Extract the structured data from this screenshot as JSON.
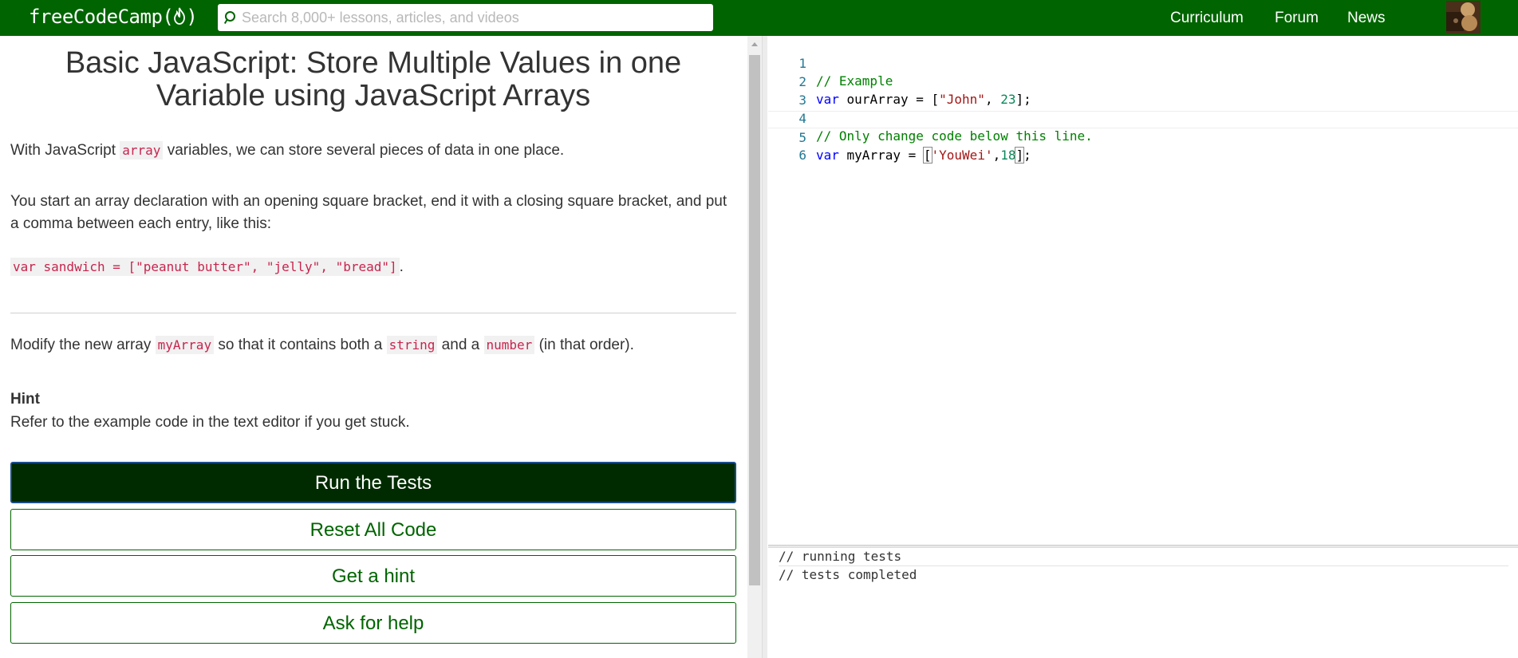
{
  "nav": {
    "logo_text": "freeCodeCamp(",
    "logo_close": ")",
    "search_placeholder": "Search 8,000+ lessons, articles, and videos",
    "links": [
      "Curriculum",
      "Forum",
      "News"
    ],
    "colors": {
      "nav_bg": "#006400",
      "accent": "#006400"
    }
  },
  "lesson": {
    "title": "Basic JavaScript: Store Multiple Values in one Variable using JavaScript Arrays",
    "p1_pre": "With JavaScript ",
    "p1_code": "array",
    "p1_post": " variables, we can store several pieces of data in one place.",
    "p2": "You start an array declaration with an opening square bracket, end it with a closing square bracket, and put a comma between each entry, like this:",
    "p3_code": "var sandwich = [\"peanut butter\", \"jelly\", \"bread\"]",
    "p3_post": ".",
    "p4_pre": "Modify the new array ",
    "p4_code1": "myArray",
    "p4_mid1": " so that it contains both a ",
    "p4_code2": "string",
    "p4_mid2": " and a ",
    "p4_code3": "number",
    "p4_post": " (in that order).",
    "hint_heading": "Hint",
    "hint_text": "Refer to the example code in the text editor if you get stuck."
  },
  "buttons": {
    "run": "Run the Tests",
    "reset": "Reset All Code",
    "hint": "Get a hint",
    "help": "Ask for help"
  },
  "editor": {
    "line_numbers": [
      "1",
      "2",
      "3",
      "4",
      "5",
      "6"
    ],
    "l1": "// Example",
    "l2_kw": "var",
    "l2_a": " ourArray = [",
    "l2_str": "\"John\"",
    "l2_b": ", ",
    "l2_num": "23",
    "l2_c": "];",
    "l4": "// Only change code below this line.",
    "l5_kw": "var",
    "l5_a": " myArray = ",
    "l5_open": "[",
    "l5_str": "'YouWei'",
    "l5_b": ",",
    "l5_num": "18",
    "l5_close": "]",
    "l5_c": ";"
  },
  "output": {
    "lines": [
      "// running tests",
      "// tests completed"
    ]
  }
}
